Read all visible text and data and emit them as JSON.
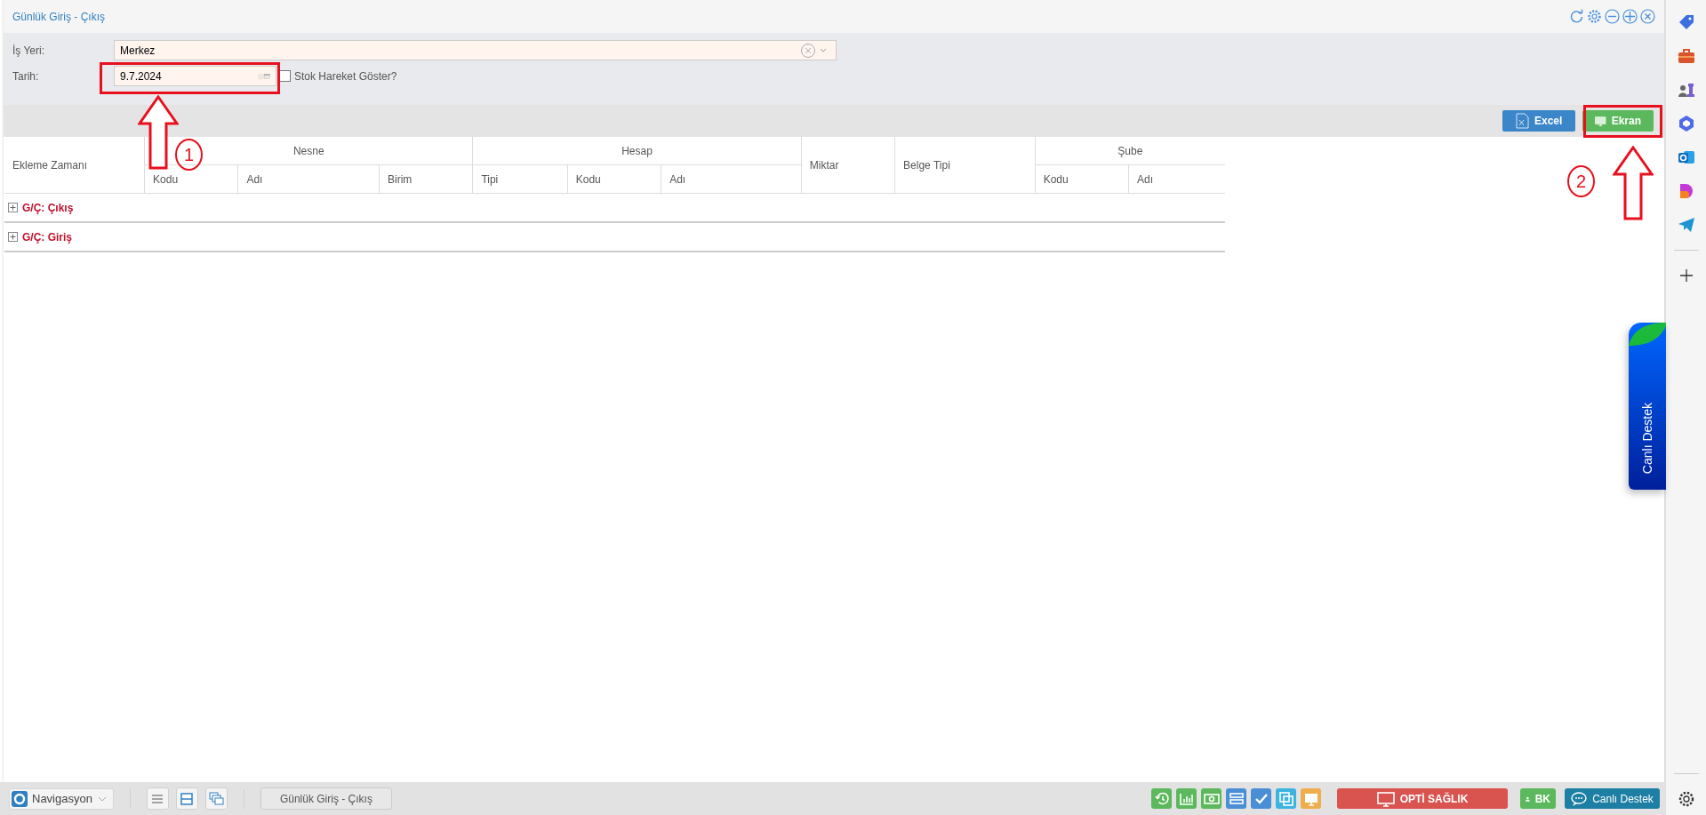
{
  "window": {
    "title": "Günlük Giriş - Çıkış"
  },
  "window_controls": [
    {
      "kind": "refresh"
    },
    {
      "kind": "settings"
    },
    {
      "kind": "minimize"
    },
    {
      "kind": "maximize"
    },
    {
      "kind": "close"
    }
  ],
  "filters": {
    "workplace": {
      "label": "İş Yeri:",
      "value": "Merkez"
    },
    "date": {
      "label": "Tarih:",
      "value": "9.7.2024"
    },
    "show_stock": {
      "label": "Stok Hareket Göster?",
      "checked": false
    }
  },
  "toolbar": {
    "buttons": [
      {
        "label": "Excel",
        "kind": "excel"
      },
      {
        "label": "Ekran",
        "kind": "screen"
      }
    ]
  },
  "table": {
    "columns": [
      {
        "label": "Ekleme Zamanı"
      },
      {
        "label": "Nesne",
        "children": [
          "Kodu",
          "Adı",
          "Birim"
        ]
      },
      {
        "label": "Hesap",
        "children": [
          "Tipi",
          "Kodu",
          "Adı"
        ]
      },
      {
        "label": "Miktar"
      },
      {
        "label": "Belge Tipi"
      },
      {
        "label": "Şube",
        "children": [
          "Kodu",
          "Adı"
        ]
      }
    ],
    "groups": [
      {
        "label": "G/Ç: Çıkış",
        "expanded": false
      },
      {
        "label": "G/Ç: Giriş",
        "expanded": false
      }
    ]
  },
  "annotations": [
    {
      "number": "1"
    },
    {
      "number": "2"
    }
  ],
  "live_support_tab": {
    "label": "Canlı Destek"
  },
  "taskbar": {
    "navigation": {
      "label": "Navigasyon"
    },
    "open_windows": [
      {
        "label": "Günlük Giriş - Çıkış"
      }
    ],
    "tool_buttons": [
      {
        "kind": "history",
        "color": "#5cb85c"
      },
      {
        "kind": "chart",
        "color": "#5cb85c"
      },
      {
        "kind": "money",
        "color": "#5cb85c"
      },
      {
        "kind": "server",
        "color": "#4a8fd6"
      },
      {
        "kind": "check",
        "color": "#4a8fd6"
      },
      {
        "kind": "windows",
        "color": "#3db4e0"
      },
      {
        "kind": "monitor",
        "color": "#f0ad4e"
      }
    ],
    "buttons": [
      {
        "label": "OPTİ SAĞLIK",
        "kind": "health"
      },
      {
        "label": "BK",
        "kind": "user"
      },
      {
        "label": "Canlı Destek",
        "kind": "chat"
      }
    ]
  }
}
